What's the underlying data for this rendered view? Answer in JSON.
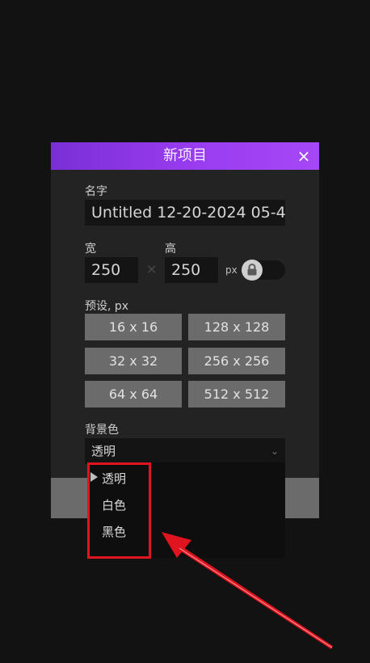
{
  "dialog": {
    "title": "新项目",
    "close_symbol": "×",
    "name_label": "名字",
    "name_value": "Untitled 12-20-2024 05-4",
    "width_label": "宽",
    "height_label": "高",
    "width_value": "250",
    "height_value": "250",
    "times_symbol": "×",
    "unit": "px",
    "aspect_lock": "lock-icon",
    "presets_label": "预设, px",
    "presets": [
      "16 x 16",
      "128 x 128",
      "32 x 32",
      "256 x 256",
      "64 x 64",
      "512 x 512"
    ],
    "background_label": "背景色",
    "background_value": "透明"
  },
  "dropdown": {
    "options": [
      "透明",
      "白色",
      "黑色"
    ],
    "selected_index": 0
  },
  "annotation": {
    "highlight_color": "#e0141e"
  },
  "colors": {
    "title_gradient_start": "#7a2fd6",
    "title_gradient_end": "#a648f6",
    "dialog_bg": "#232323",
    "field_bg": "#141414",
    "preset_bg": "#6b6b6b"
  }
}
